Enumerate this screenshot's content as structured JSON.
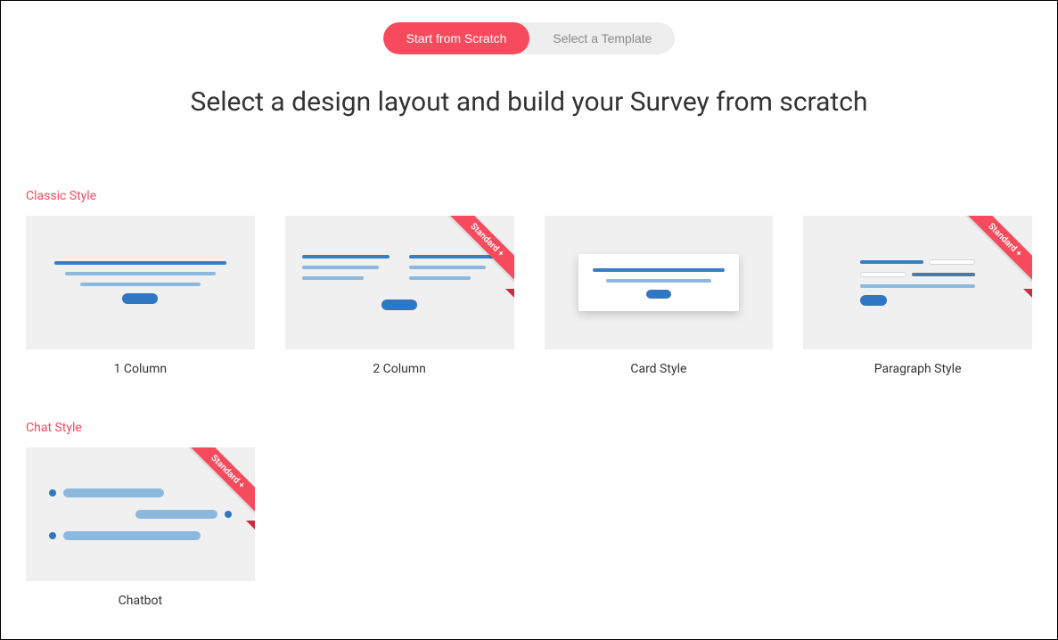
{
  "tabs": {
    "scratch": "Start from Scratch",
    "template": "Select a Template"
  },
  "page_title": "Select a design layout and build your Survey from scratch",
  "badge": "Standard +",
  "sections": {
    "classic": {
      "label": "Classic Style",
      "items": [
        {
          "name": "1 Column",
          "badge": false
        },
        {
          "name": "2 Column",
          "badge": true
        },
        {
          "name": "Card Style",
          "badge": false
        },
        {
          "name": "Paragraph Style",
          "badge": true
        }
      ]
    },
    "chat": {
      "label": "Chat Style",
      "items": [
        {
          "name": "Chatbot",
          "badge": true
        }
      ]
    }
  }
}
